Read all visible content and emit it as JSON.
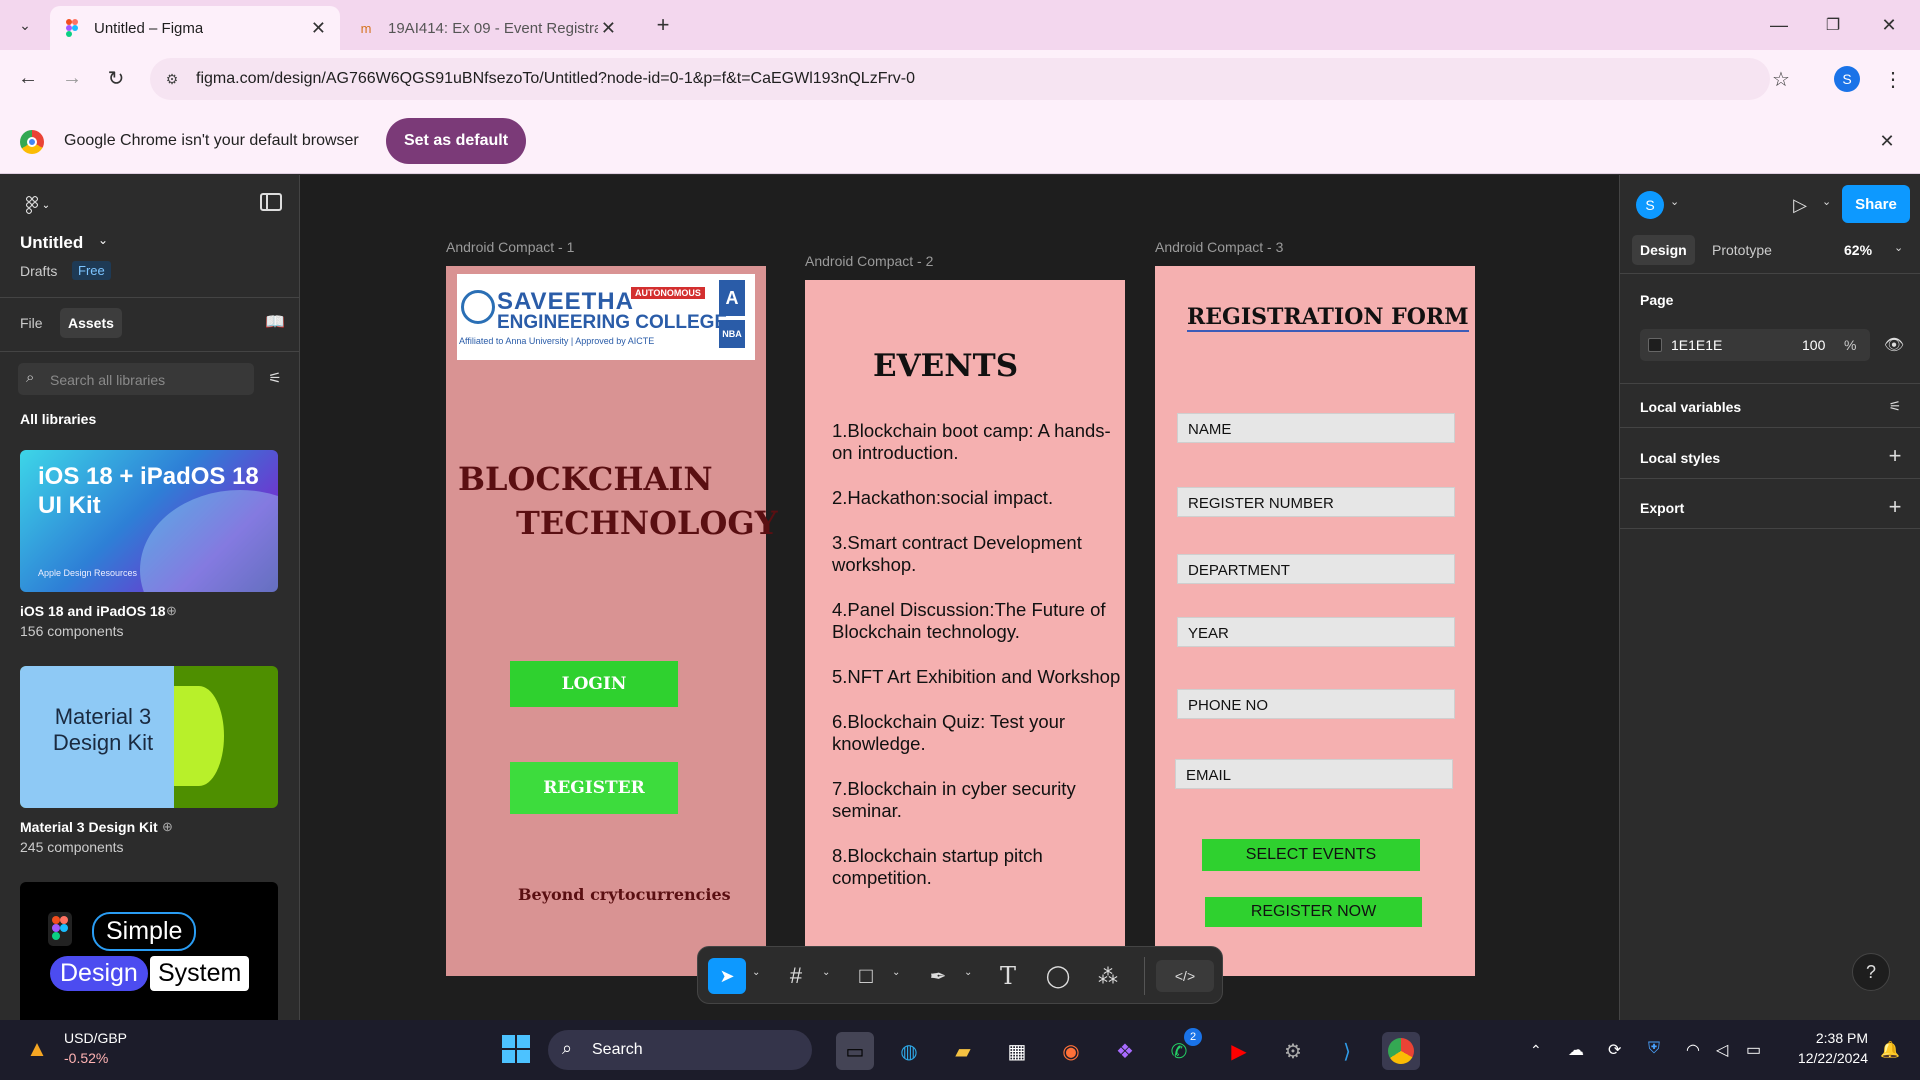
{
  "browser": {
    "tabs": [
      {
        "title": "Untitled – Figma"
      },
      {
        "title": "19AI414: Ex 09 - Event Registrat"
      }
    ],
    "url": "figma.com/design/AG766W6QGS91uBNfsezoTo/Untitled?node-id=0-1&p=f&t=CaEGWl193nQLzFrv-0",
    "profile_initial": "S",
    "infobar_text": "Google Chrome isn't your default browser",
    "infobar_button": "Set as default"
  },
  "figma": {
    "file_name": "Untitled",
    "location": "Drafts",
    "plan_badge": "Free",
    "left_tabs": [
      "File",
      "Assets"
    ],
    "search_placeholder": "Search all libraries",
    "all_libraries_label": "All libraries",
    "libraries": [
      {
        "thumb_text": "iOS 18 + iPadOS 18 UI Kit",
        "thumb_sub": "Apple Design Resources",
        "name": "iOS 18 and iPadOS 18",
        "count": "156 components"
      },
      {
        "thumb_text": "Material 3 Design Kit",
        "name": "Material 3 Design Kit",
        "count": "245 components"
      },
      {
        "thumb_words": [
          "Simple",
          "Design",
          "System"
        ]
      }
    ],
    "right": {
      "avatar": "S",
      "share_label": "Share",
      "tabs": [
        "Design",
        "Prototype"
      ],
      "zoom": "62%",
      "page_label": "Page",
      "page_color": "1E1E1E",
      "page_opacity": "100",
      "percent": "%",
      "sections": [
        "Local variables",
        "Local styles",
        "Export"
      ]
    },
    "help": "?"
  },
  "frames": {
    "f1": {
      "label": "Android Compact - 1",
      "college_line1": "SAVEETHA",
      "college_line2": "ENGINEERING COLLEGE",
      "college_badge": "AUTONOMOUS",
      "college_affil": "Affiliated to Anna University | Approved by AICTE",
      "naac": "A",
      "nba": "NBA",
      "title1": "BLOCKCHAIN",
      "title2": "TECHNOLOGY",
      "login": "LOGIN",
      "register": "REGISTER",
      "tagline": "Beyond crytocurrencies"
    },
    "f2": {
      "label": "Android Compact - 2",
      "heading": "EVENTS",
      "events": [
        "1.Blockchain boot camp: A hands-on introduction.",
        "2.Hackathon:social impact.",
        "3.Smart contract Development workshop.",
        "4.Panel Discussion:The Future of Blockchain technology.",
        "5.NFT Art Exhibition and Workshop",
        "6.Blockchain Quiz: Test your knowledge.",
        "7.Blockchain in cyber security seminar.",
        "8.Blockchain startup pitch competition."
      ]
    },
    "f3": {
      "label": "Android Compact - 3",
      "heading": "REGISTRATION FORM",
      "fields": [
        "NAME",
        "REGISTER NUMBER",
        "DEPARTMENT",
        "YEAR",
        "PHONE NO",
        "EMAIL"
      ],
      "select_events": "SELECT EVENTS",
      "register_now": "REGISTER NOW"
    }
  },
  "taskbar": {
    "ticker": "USD/GBP",
    "ticker_change": "-0.52%",
    "search": "Search",
    "whatsapp_badge": "2",
    "time": "2:38 PM",
    "date": "12/22/2024"
  },
  "colors": {
    "frame1_bg": "#d99393",
    "frame_bg": "#f5b0b0",
    "button_green": "#2fd12f",
    "figma_blue": "#0d99ff",
    "chrome_accent": "#7b3a78"
  }
}
